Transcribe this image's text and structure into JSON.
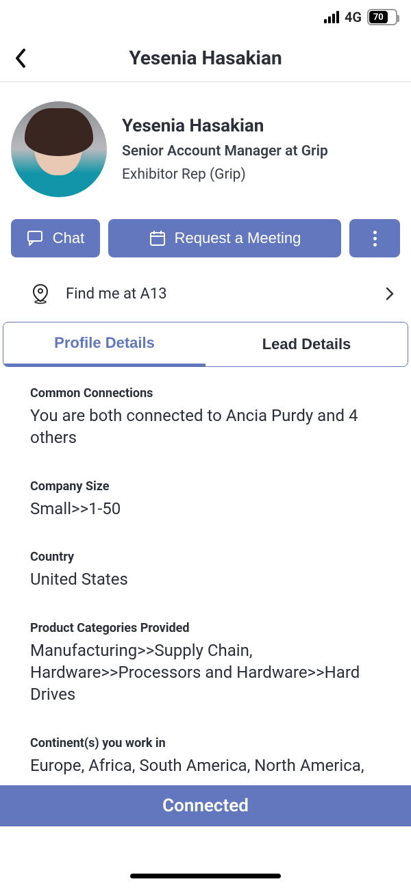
{
  "status": {
    "network_label": "4G",
    "battery_pct": "70"
  },
  "nav": {
    "title": "Yesenia Hasakian"
  },
  "profile": {
    "name": "Yesenia Hasakian",
    "title": "Senior Account Manager at Grip",
    "role": "Exhibitor Rep (Grip)"
  },
  "actions": {
    "chat_label": "Chat",
    "meeting_label": "Request a Meeting"
  },
  "find": {
    "label": "Find me at A13"
  },
  "tabs": {
    "profile": "Profile Details",
    "lead": "Lead Details"
  },
  "details": {
    "common_connections": {
      "label": "Common Connections",
      "value": "You are both connected to Ancia Purdy and 4 others"
    },
    "company_size": {
      "label": "Company Size",
      "value": "Small>>1-50"
    },
    "country": {
      "label": "Country",
      "value": "United States"
    },
    "product_categories": {
      "label": "Product Categories Provided",
      "value": "Manufacturing>>Supply Chain, Hardware>>Processors and Hardware>>Hard Drives"
    },
    "continents": {
      "label": "Continent(s) you work in",
      "value": "Europe, Africa, South America, North America,"
    }
  },
  "footer": {
    "status": "Connected"
  }
}
